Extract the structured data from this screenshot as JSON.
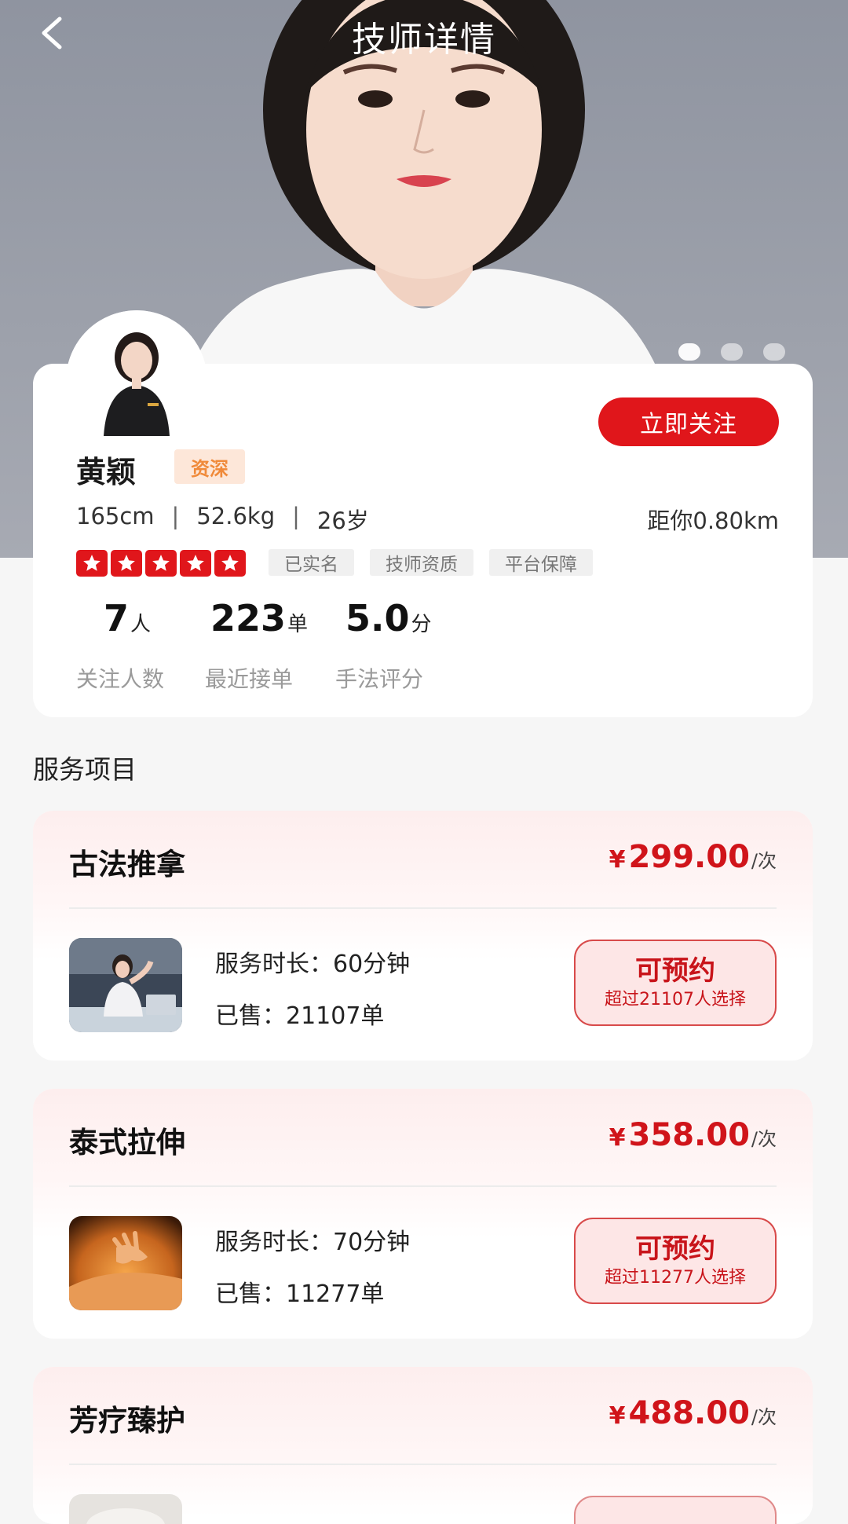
{
  "header": {
    "title": "技师详情",
    "back_icon": "chevron-left-icon"
  },
  "carousel": {
    "count": 3,
    "active_index": 0
  },
  "profile": {
    "name": "黄颖",
    "level_badge": "资深",
    "height": "165cm",
    "weight": "52.6kg",
    "age": "26岁",
    "separator": "|",
    "distance": "距你0.80km",
    "follow_button": "立即关注",
    "rating_stars": 5,
    "tags": [
      "已实名",
      "技师资质",
      "平台保障"
    ],
    "metrics": [
      {
        "value": "7",
        "unit": "人",
        "label": "关注人数"
      },
      {
        "value": "223",
        "unit": "单",
        "label": "最近接单"
      },
      {
        "value": "5.0",
        "unit": "分",
        "label": "手法评分"
      }
    ]
  },
  "services_section": {
    "title": "服务项目",
    "items": [
      {
        "name": "古法推拿",
        "currency": "¥",
        "price": "299.00",
        "per": "/次",
        "duration": "服务时长：60分钟",
        "sold": "已售：21107单",
        "book_label": "可预约",
        "book_sub": "超过21107人选择"
      },
      {
        "name": "泰式拉伸",
        "currency": "¥",
        "price": "358.00",
        "per": "/次",
        "duration": "服务时长：70分钟",
        "sold": "已售：11277单",
        "book_label": "可预约",
        "book_sub": "超过11277人选择"
      },
      {
        "name": "芳疗臻护",
        "currency": "¥",
        "price": "488.00",
        "per": "/次",
        "duration": "",
        "sold": "",
        "book_label": "",
        "book_sub": ""
      }
    ]
  },
  "colors": {
    "accent_red": "#e0161b",
    "price_red": "#d0141a",
    "badge_orange": "#f08a3a",
    "badge_bg": "#fde7d9",
    "page_bg": "#f6f6f6"
  }
}
